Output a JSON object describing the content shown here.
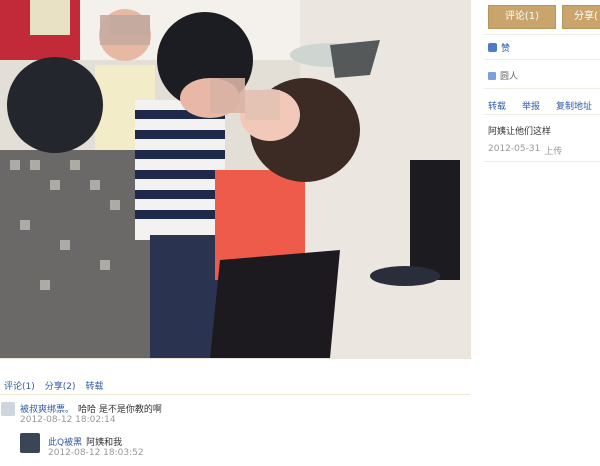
{
  "sidebar": {
    "comment_tab": "评论(1)",
    "share_tab": "分享(",
    "like": "赞",
    "user": "圆人",
    "actions": [
      "转载",
      "举报",
      "复制地址"
    ],
    "title": "阿姨让他们这样",
    "date": "2012-05-31",
    "upload": "上传"
  },
  "bottom": {
    "tabs": [
      "评论(1)",
      "分享(2)",
      "转载"
    ],
    "comments": [
      {
        "user": "被叔爽绑票。",
        "text": "哈哈 是不是你教的啊",
        "time": "2012-08-12 18:02:14"
      },
      {
        "user": "此Q被黑",
        "text": "阿姨和我",
        "time": "2012-08-12 18:03:52"
      }
    ]
  },
  "colors": {
    "accent": "#c9a56d",
    "link": "#2f5aa6",
    "muted": "#999999"
  }
}
